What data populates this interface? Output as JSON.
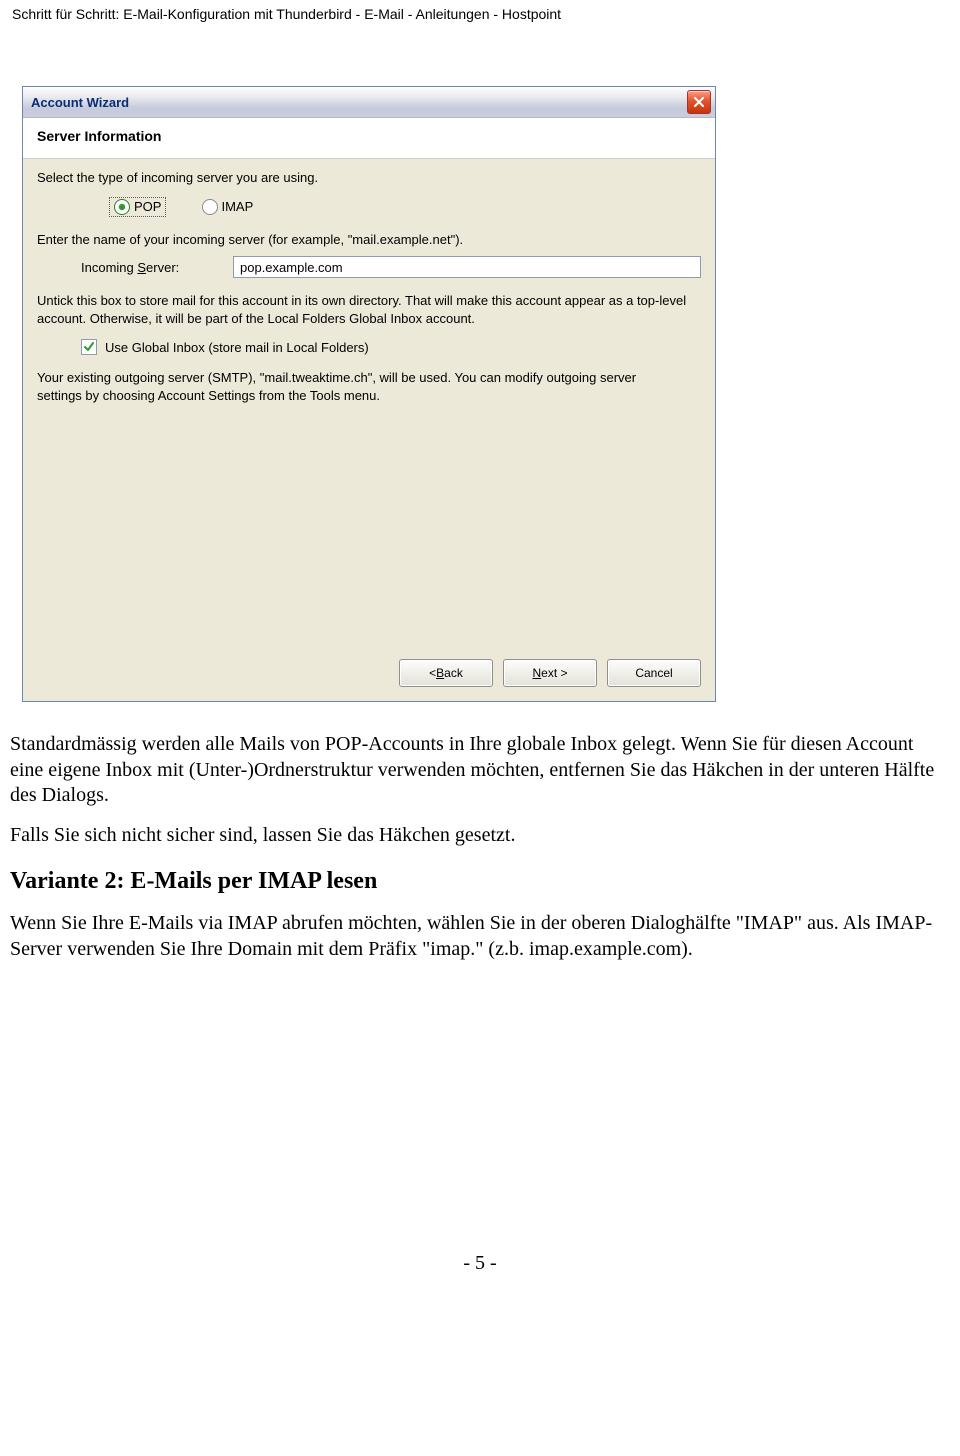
{
  "doc": {
    "header": "Schritt für Schritt: E-Mail-Konfiguration mit Thunderbird - E-Mail - Anleitungen - Hostpoint",
    "page_num": "- 5 -"
  },
  "dialog": {
    "title": "Account Wizard",
    "section": "Server Information",
    "select_type": "Select the type of incoming server you are using.",
    "radio_pop": "POP",
    "radio_imap": "IMAP",
    "enter_name": "Enter the name of your incoming server (for example, \"mail.example.net\").",
    "incoming_label": "Incoming Server:",
    "incoming_value": "pop.example.com",
    "untick_text": "Untick this box to store mail for this account in its own directory. That will make this account appear as a top-level account. Otherwise, it will be part of the Local Folders Global Inbox account.",
    "checkbox_label": "Use Global Inbox (store mail in Local Folders)",
    "smtp_text": "Your existing outgoing server (SMTP), \"mail.tweaktime.ch\", will be used. You can modify outgoing server settings by choosing Account Settings from the Tools menu.",
    "btn_back": "< Back",
    "btn_next": "Next >",
    "btn_cancel": "Cancel"
  },
  "body": {
    "p1": "Standardmässig werden alle Mails von POP-Accounts in Ihre globale Inbox gelegt. Wenn Sie für diesen Account eine eigene Inbox mit (Unter-)Ordnerstruktur verwenden möchten, entfernen Sie das Häkchen in der unteren Hälfte des Dialogs.",
    "p2": "Falls Sie sich nicht sicher sind, lassen Sie das Häkchen gesetzt.",
    "h2": "Variante 2: E-Mails per IMAP lesen",
    "p3": "Wenn Sie Ihre E-Mails via IMAP abrufen möchten, wählen Sie in der oberen Dialoghälfte \"IMAP\" aus. Als IMAP-Server verwenden Sie Ihre Domain mit dem Präfix \"imap.\" (z.b. imap.example.com)."
  }
}
